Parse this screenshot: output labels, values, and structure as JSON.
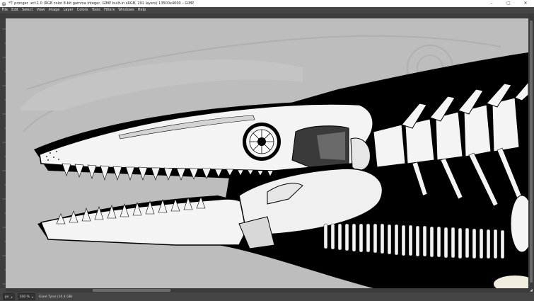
{
  "window": {
    "title": "*T. pronger .xcf-1.0 (RGB color 8-bit gamma integer, GIMP built-in sRGB, 291 layers) 13500x4000 – GIMP",
    "controls": {
      "minimize": "–",
      "maximize": "▢",
      "close": "✕"
    }
  },
  "menu": {
    "items": [
      "File",
      "Edit",
      "Select",
      "View",
      "Image",
      "Layer",
      "Colors",
      "Tools",
      "Filters",
      "Windows",
      "Help"
    ]
  },
  "status": {
    "unit": "px",
    "zoom": "100 %",
    "message": "Giant Tylos (10.4 GB)"
  },
  "icons": {
    "app": "gimp-icon",
    "nav": "navigate-icon",
    "zoom_toggle": "zoom-toggle-icon"
  },
  "colors": {
    "canvas_background": "#bdbdbd",
    "ui_dark": "#454545",
    "silhouette": "#000000",
    "bone": "#f2f2f2"
  }
}
